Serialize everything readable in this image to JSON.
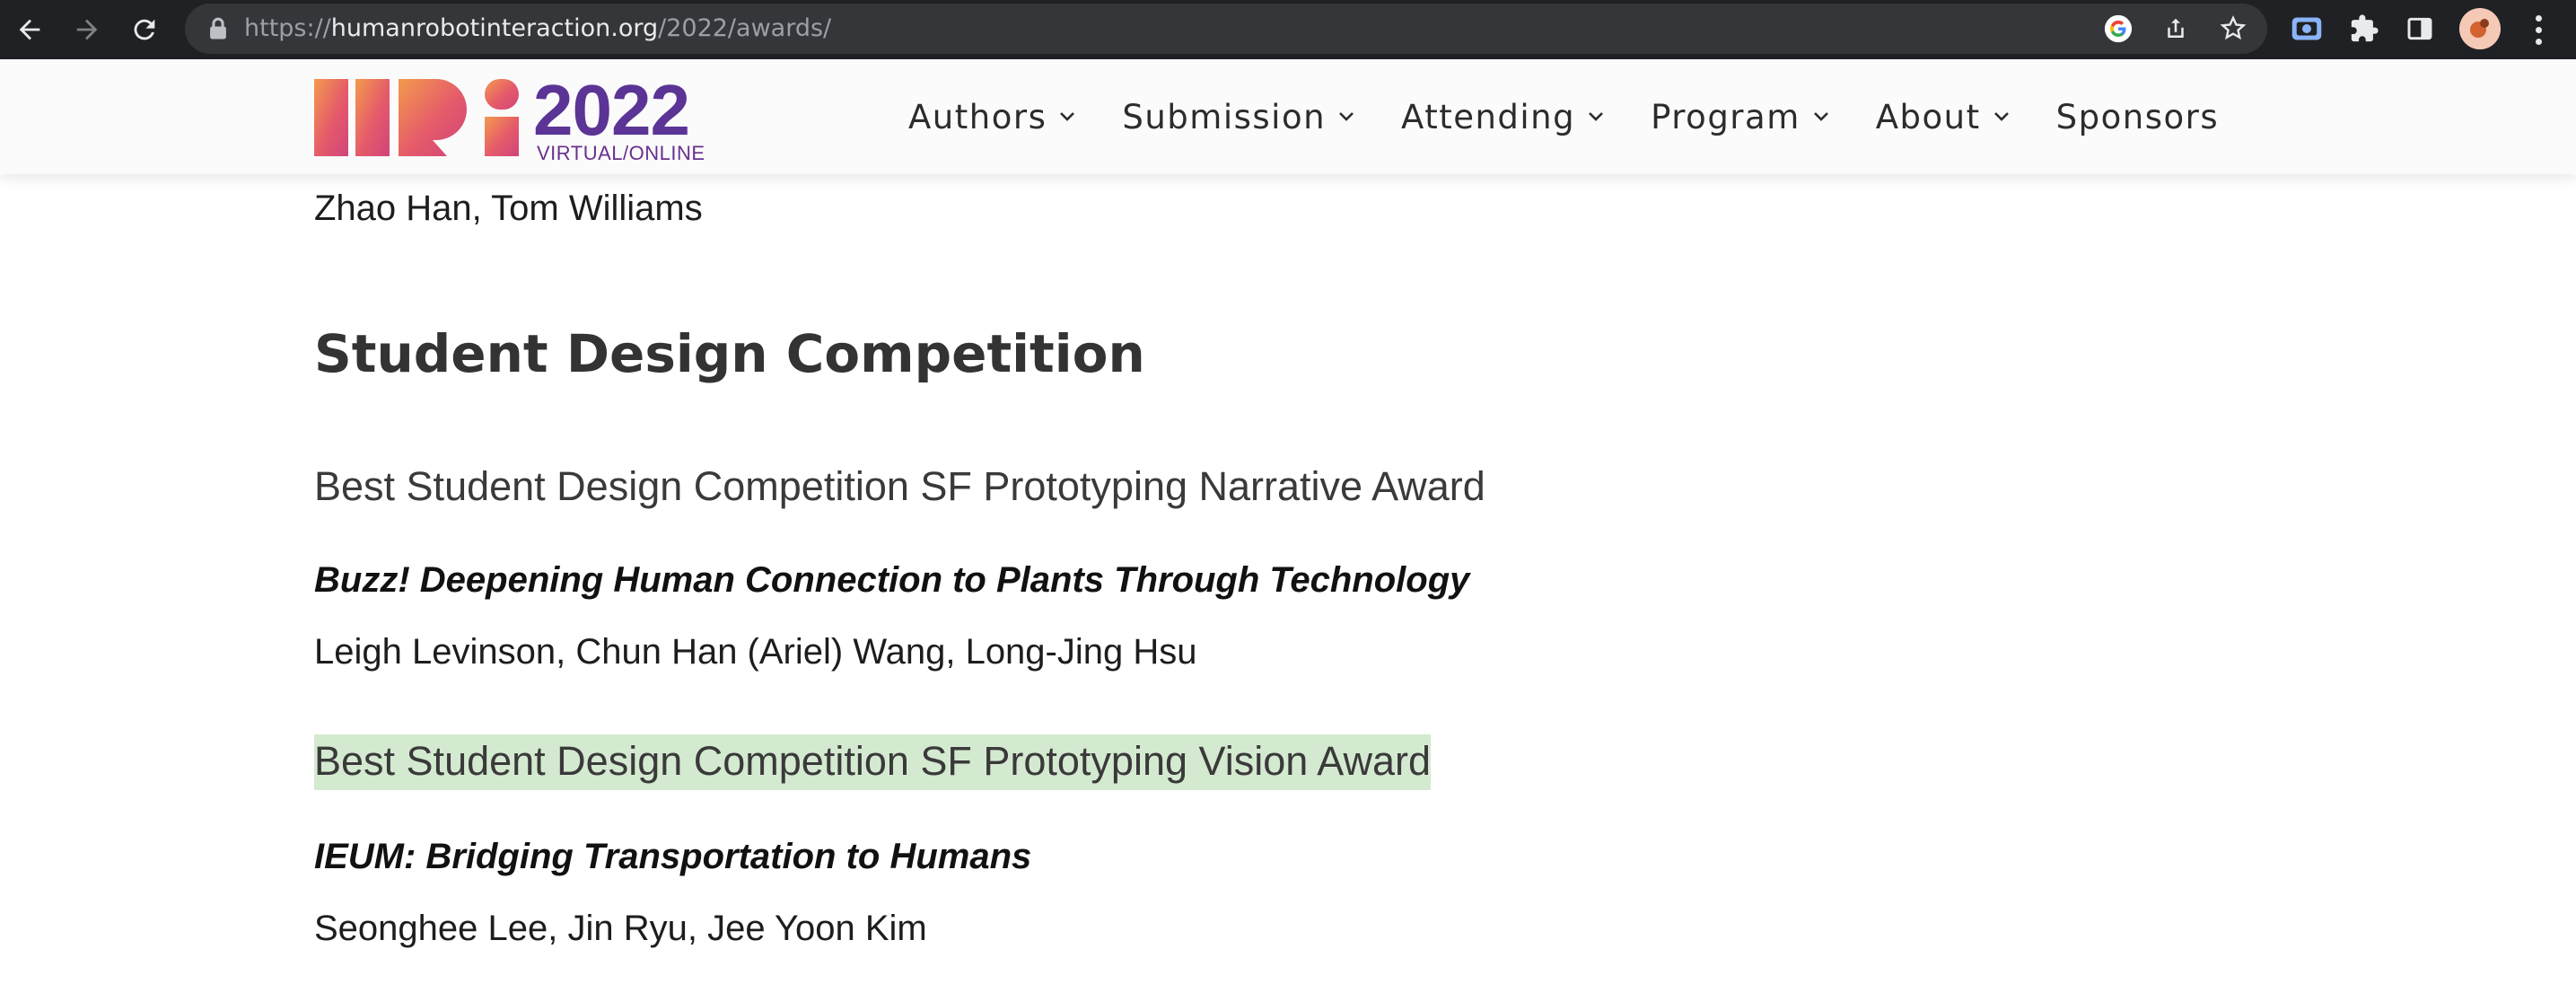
{
  "browser": {
    "url_scheme": "https://",
    "url_host": "humanrobotinteraction.org",
    "url_path": "/2022/awards/"
  },
  "site": {
    "logo": {
      "year": "2022",
      "subtitle": "VIRTUAL/ONLINE",
      "colors": [
        "#f08a4b",
        "#e4566f",
        "#c0407f",
        "#5b3496"
      ]
    },
    "nav": [
      {
        "label": "Authors",
        "has_dropdown": true
      },
      {
        "label": "Submission",
        "has_dropdown": true
      },
      {
        "label": "Attending",
        "has_dropdown": true
      },
      {
        "label": "Program",
        "has_dropdown": true
      },
      {
        "label": "About",
        "has_dropdown": true
      },
      {
        "label": "Sponsors",
        "has_dropdown": false
      }
    ]
  },
  "content": {
    "previous_authors": "Zhao Han, Tom Williams",
    "section_title": "Student Design Competition",
    "awards": [
      {
        "award_name": "Best Student Design Competition SF Prototyping Narrative Award",
        "paper_title": "Buzz! Deepening Human Connection to Plants Through Technology",
        "authors": "Leigh Levinson, Chun Han (Ariel) Wang, Long-Jing Hsu",
        "highlighted": false
      },
      {
        "award_name": "Best Student Design Competition SF Prototyping Vision Award",
        "paper_title": "IEUM: Bridging Transportation to Humans",
        "authors": "Seonghee Lee, Jin Ryu, Jee Yoon Kim",
        "highlighted": true,
        "highlight_color": "#d4ead0"
      }
    ]
  }
}
